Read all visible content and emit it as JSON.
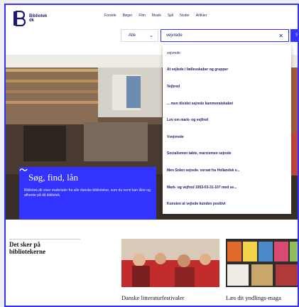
{
  "logo": {
    "line1": "Bibliotek",
    "line2": "dk"
  },
  "nav": [
    "Forside",
    "Bøger",
    "Film",
    "Musik",
    "Spil",
    "Noder",
    "Artikler"
  ],
  "search": {
    "category": "Alle",
    "query": "vejvrede",
    "button": "S"
  },
  "suggestions": [
    "vejvrede",
    "At vejlede i fællesskaber og grupper",
    "Vejbred",
    "... men tilsidst sejrede kammeratskabet",
    "Lov om mark- og vejfred",
    "Vvejvrede",
    "Socialismen tabte, marxismen sejrede",
    "Men Solen sejrede. versat fra Hollandsk v...",
    "Mark- og vejfred 1953-03-31-107 med se...",
    "Kunsten at vejlede kunden positivt"
  ],
  "hero": {
    "title": "Søg, find, lån",
    "text": "Bibliotek.dk viser materialer fra alle danske biblioteker, som du nemt kan låne og afhente på dit bibliotek."
  },
  "events": {
    "heading": "Det sker på bibliotekerne",
    "cards": [
      "Danske litteraturfestivaler",
      "Læs dit yndlings-maga"
    ]
  },
  "colors": {
    "accent": "#3333ff",
    "text": "#1a1a6e"
  }
}
